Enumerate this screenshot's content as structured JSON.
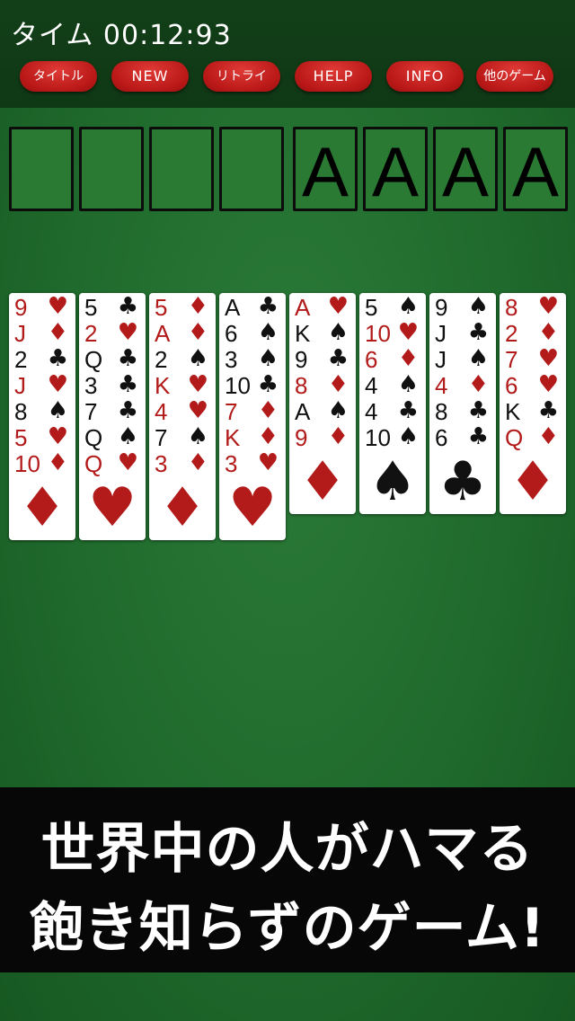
{
  "header": {
    "timer_label": "タイム 00:12:93"
  },
  "menu": [
    {
      "label": "タイトル",
      "name": "title-button"
    },
    {
      "label": "NEW",
      "name": "new-button"
    },
    {
      "label": "リトライ",
      "name": "retry-button"
    },
    {
      "label": "HELP",
      "name": "help-button"
    },
    {
      "label": "INFO",
      "name": "info-button"
    },
    {
      "label": "他のゲーム",
      "name": "other-games-button"
    }
  ],
  "free_cells": [
    "",
    "",
    "",
    ""
  ],
  "foundations": [
    "A",
    "A",
    "A",
    "A"
  ],
  "tableau": [
    {
      "cards": [
        [
          "9",
          "heart"
        ],
        [
          "J",
          "diamond"
        ],
        [
          "2",
          "club"
        ],
        [
          "J",
          "heart"
        ],
        [
          "8",
          "spade"
        ],
        [
          "5",
          "heart"
        ],
        [
          "10",
          "diamond"
        ]
      ],
      "big": "diamond"
    },
    {
      "cards": [
        [
          "5",
          "club"
        ],
        [
          "2",
          "heart"
        ],
        [
          "Q",
          "club"
        ],
        [
          "3",
          "club"
        ],
        [
          "7",
          "club"
        ],
        [
          "Q",
          "spade"
        ],
        [
          "Q",
          "heart"
        ]
      ],
      "big": "heart"
    },
    {
      "cards": [
        [
          "5",
          "diamond"
        ],
        [
          "A",
          "diamond"
        ],
        [
          "2",
          "spade"
        ],
        [
          "K",
          "heart"
        ],
        [
          "4",
          "heart"
        ],
        [
          "7",
          "spade"
        ],
        [
          "3",
          "diamond"
        ]
      ],
      "big": "diamond"
    },
    {
      "cards": [
        [
          "A",
          "club"
        ],
        [
          "6",
          "spade"
        ],
        [
          "3",
          "spade"
        ],
        [
          "10",
          "club"
        ],
        [
          "7",
          "diamond"
        ],
        [
          "K",
          "diamond"
        ],
        [
          "3",
          "heart"
        ]
      ],
      "big": "heart"
    },
    {
      "cards": [
        [
          "A",
          "heart"
        ],
        [
          "K",
          "spade"
        ],
        [
          "9",
          "club"
        ],
        [
          "8",
          "diamond"
        ],
        [
          "A",
          "spade"
        ],
        [
          "9",
          "diamond"
        ]
      ],
      "big": "diamond"
    },
    {
      "cards": [
        [
          "5",
          "spade"
        ],
        [
          "10",
          "heart"
        ],
        [
          "6",
          "diamond"
        ],
        [
          "4",
          "spade"
        ],
        [
          "4",
          "club"
        ],
        [
          "10",
          "spade"
        ]
      ],
      "big": "spade"
    },
    {
      "cards": [
        [
          "9",
          "spade"
        ],
        [
          "J",
          "club"
        ],
        [
          "J",
          "spade"
        ],
        [
          "4",
          "diamond"
        ],
        [
          "8",
          "club"
        ],
        [
          "6",
          "club"
        ]
      ],
      "big": "club"
    },
    {
      "cards": [
        [
          "8",
          "heart"
        ],
        [
          "2",
          "diamond"
        ],
        [
          "7",
          "heart"
        ],
        [
          "6",
          "heart"
        ],
        [
          "K",
          "club"
        ],
        [
          "Q",
          "diamond"
        ]
      ],
      "big": "diamond"
    }
  ],
  "banner": {
    "line1": "世界中の人がハマる",
    "line2": "飽き知らずのゲーム!"
  }
}
